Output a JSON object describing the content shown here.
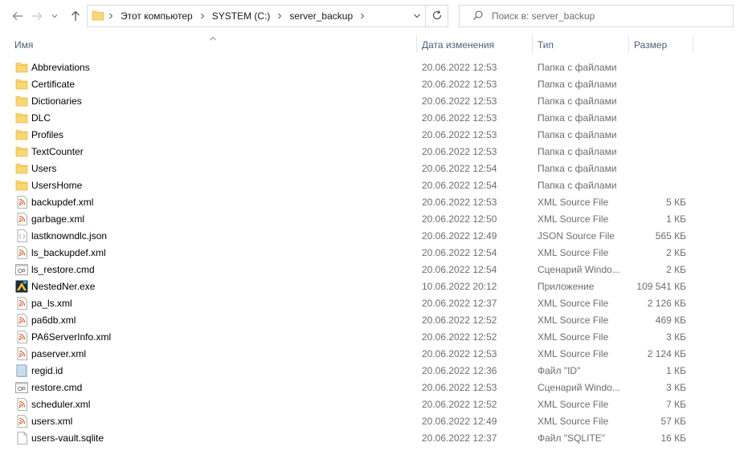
{
  "toolbar": {
    "back_icon": "arrow-left-icon",
    "forward_icon": "arrow-right-icon",
    "recent_icon": "chevron-down-icon",
    "up_icon": "arrow-up-icon",
    "refresh_icon": "refresh-icon"
  },
  "address": {
    "crumbs": [
      "Этот компьютер",
      "SYSTEM (C:)",
      "server_backup"
    ]
  },
  "search": {
    "placeholder": "Поиск в: server_backup"
  },
  "columns": {
    "name": "Имя",
    "date": "Дата изменения",
    "type": "Тип",
    "size": "Размер"
  },
  "colors": {
    "folder": "#f8d775",
    "folder_dark": "#e8b84a",
    "xml": "#d9531e",
    "header_text": "#4c607a",
    "meta_text": "#6d6d6d"
  },
  "files": [
    {
      "name": "Abbreviations",
      "date": "20.06.2022 12:53",
      "type": "Папка с файлами",
      "size": "",
      "icon": "folder-icon"
    },
    {
      "name": "Certificate",
      "date": "20.06.2022 12:53",
      "type": "Папка с файлами",
      "size": "",
      "icon": "folder-icon"
    },
    {
      "name": "Dictionaries",
      "date": "20.06.2022 12:53",
      "type": "Папка с файлами",
      "size": "",
      "icon": "folder-icon"
    },
    {
      "name": "DLC",
      "date": "20.06.2022 12:53",
      "type": "Папка с файлами",
      "size": "",
      "icon": "folder-icon"
    },
    {
      "name": "Profiles",
      "date": "20.06.2022 12:53",
      "type": "Папка с файлами",
      "size": "",
      "icon": "folder-icon"
    },
    {
      "name": "TextCounter",
      "date": "20.06.2022 12:53",
      "type": "Папка с файлами",
      "size": "",
      "icon": "folder-icon"
    },
    {
      "name": "Users",
      "date": "20.06.2022 12:54",
      "type": "Папка с файлами",
      "size": "",
      "icon": "folder-icon"
    },
    {
      "name": "UsersHome",
      "date": "20.06.2022 12:54",
      "type": "Папка с файлами",
      "size": "",
      "icon": "folder-icon"
    },
    {
      "name": "backupdef.xml",
      "date": "20.06.2022 12:53",
      "type": "XML Source File",
      "size": "5 КБ",
      "icon": "xml-file-icon"
    },
    {
      "name": "garbage.xml",
      "date": "20.06.2022 12:50",
      "type": "XML Source File",
      "size": "1 КБ",
      "icon": "xml-file-icon"
    },
    {
      "name": "lastknowndlc.json",
      "date": "20.06.2022 12:49",
      "type": "JSON Source File",
      "size": "565 КБ",
      "icon": "json-file-icon"
    },
    {
      "name": "ls_backupdef.xml",
      "date": "20.06.2022 12:54",
      "type": "XML Source File",
      "size": "2 КБ",
      "icon": "xml-file-icon"
    },
    {
      "name": "ls_restore.cmd",
      "date": "20.06.2022 12:54",
      "type": "Сценарий Windo...",
      "size": "2 КБ",
      "icon": "cmd-file-icon"
    },
    {
      "name": "NestedNer.exe",
      "date": "10.06.2022 20:12",
      "type": "Приложение",
      "size": "109 541 КБ",
      "icon": "exe-file-icon"
    },
    {
      "name": "pa_ls.xml",
      "date": "20.06.2022 12:37",
      "type": "XML Source File",
      "size": "2 126 КБ",
      "icon": "xml-file-icon"
    },
    {
      "name": "pa6db.xml",
      "date": "20.06.2022 12:52",
      "type": "XML Source File",
      "size": "469 КБ",
      "icon": "xml-file-icon"
    },
    {
      "name": "PA6ServerInfo.xml",
      "date": "20.06.2022 12:52",
      "type": "XML Source File",
      "size": "3 КБ",
      "icon": "xml-file-icon"
    },
    {
      "name": "paserver.xml",
      "date": "20.06.2022 12:53",
      "type": "XML Source File",
      "size": "2 124 КБ",
      "icon": "xml-file-icon"
    },
    {
      "name": "regid.id",
      "date": "20.06.2022 12:36",
      "type": "Файл \"ID\"",
      "size": "1 КБ",
      "icon": "id-file-icon"
    },
    {
      "name": "restore.cmd",
      "date": "20.06.2022 12:53",
      "type": "Сценарий Windo...",
      "size": "3 КБ",
      "icon": "cmd-file-icon"
    },
    {
      "name": "scheduler.xml",
      "date": "20.06.2022 12:52",
      "type": "XML Source File",
      "size": "7 КБ",
      "icon": "xml-file-icon"
    },
    {
      "name": "users.xml",
      "date": "20.06.2022 12:49",
      "type": "XML Source File",
      "size": "57 КБ",
      "icon": "xml-file-icon"
    },
    {
      "name": "users-vault.sqlite",
      "date": "20.06.2022 12:37",
      "type": "Файл \"SQLITE\"",
      "size": "16 КБ",
      "icon": "blank-file-icon"
    }
  ]
}
